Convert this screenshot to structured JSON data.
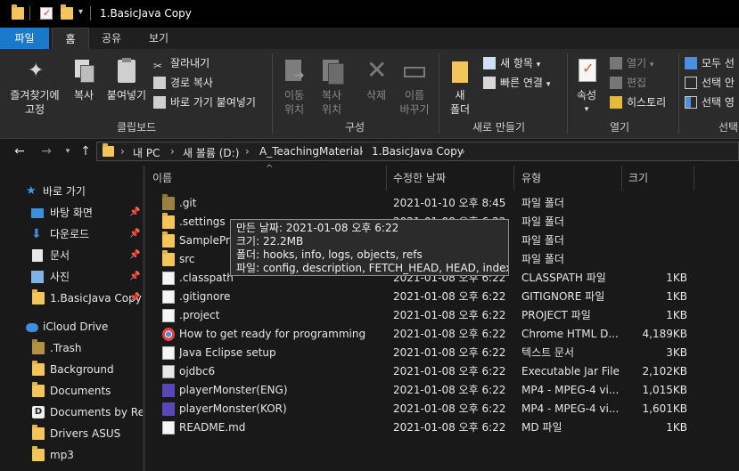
{
  "window": {
    "title": "1.BasicJava Copy"
  },
  "tabs": [
    {
      "label": "파일"
    },
    {
      "label": "홈"
    },
    {
      "label": "공유"
    },
    {
      "label": "보기"
    }
  ],
  "ribbon": {
    "clipboard": {
      "pin_label_1": "즐겨찾기에",
      "pin_label_2": "고정",
      "copy": "복사",
      "paste": "붙여넣기",
      "cut": "잘라내기",
      "copy_path": "경로 복사",
      "paste_shortcut": "바로 가기 붙여넣기",
      "group": "클립보드"
    },
    "organize": {
      "move_1": "이동",
      "move_2": "위치",
      "copyto_1": "복사",
      "copyto_2": "위치",
      "delete": "삭제",
      "rename_1": "이름",
      "rename_2": "바꾸기",
      "group": "구성"
    },
    "new": {
      "folder_1": "새",
      "folder_2": "폴더",
      "new_item": "새 항목",
      "easy_access": "빠른 연결",
      "group": "새로 만들기"
    },
    "open": {
      "properties": "속성",
      "open": "열기",
      "edit": "편집",
      "history": "히스토리",
      "group": "열기"
    },
    "select": {
      "select_all": "모두 선",
      "select_none": "선택 안",
      "invert": "선택 영",
      "group": "선택"
    }
  },
  "address": {
    "crumbs": [
      "내 PC",
      "새 볼륨 (D:)",
      "A_TeachingMaterial",
      "1.BasicJava Copy"
    ]
  },
  "nav": {
    "quick_access": "바로 가기",
    "items": [
      {
        "label": "바탕 화면",
        "icon": "desktop-icon"
      },
      {
        "label": "다운로드",
        "icon": "download-icon"
      },
      {
        "label": "문서",
        "icon": "document-icon"
      },
      {
        "label": "사진",
        "icon": "pictures-icon"
      },
      {
        "label": "1.BasicJava Copy",
        "icon": "folder-icon"
      }
    ],
    "icloud": "iCloud Drive",
    "icloud_items": [
      {
        "label": ".Trash"
      },
      {
        "label": "Background"
      },
      {
        "label": "Documents"
      },
      {
        "label": "Documents by Rea"
      },
      {
        "label": "Drivers ASUS"
      },
      {
        "label": "mp3"
      }
    ]
  },
  "columns": {
    "name": "이름",
    "date": "수정한 날짜",
    "type": "유형",
    "size": "크기"
  },
  "files": [
    {
      "name": ".git",
      "date": "2021-01-10 오후 8:45",
      "type": "파일 폴더",
      "size": "",
      "icon": "folder-icon",
      "dim": true
    },
    {
      "name": ".settings",
      "date": "2021-01-08 오후 6:22",
      "type": "파일 폴더",
      "size": "",
      "icon": "folder-icon"
    },
    {
      "name": "SampleProject",
      "date": "2021-01-08 오후 6:22",
      "type": "파일 폴더",
      "size": "",
      "icon": "folder-icon"
    },
    {
      "name": "src",
      "date": "2021-01-08 오후 6:22",
      "type": "파일 폴더",
      "size": "",
      "icon": "folder-icon"
    },
    {
      "name": ".classpath",
      "date": "2021-01-08 오후 6:22",
      "type": "CLASSPATH 파일",
      "size": "1KB",
      "icon": "file-icon"
    },
    {
      "name": ".gitignore",
      "date": "2021-01-08 오후 6:22",
      "type": "GITIGNORE 파일",
      "size": "1KB",
      "icon": "file-icon"
    },
    {
      "name": ".project",
      "date": "2021-01-08 오후 6:22",
      "type": "PROJECT 파일",
      "size": "1KB",
      "icon": "file-icon"
    },
    {
      "name": "How to get ready for programming",
      "date": "2021-01-08 오후 6:22",
      "type": "Chrome HTML D...",
      "size": "4,189KB",
      "icon": "chrome-icon"
    },
    {
      "name": "Java Eclipse setup",
      "date": "2021-01-08 오후 6:22",
      "type": "텍스트 문서",
      "size": "3KB",
      "icon": "text-file-icon"
    },
    {
      "name": "ojdbc6",
      "date": "2021-01-08 오후 6:22",
      "type": "Executable Jar File",
      "size": "2,102KB",
      "icon": "jar-icon"
    },
    {
      "name": "playerMonster(ENG)",
      "date": "2021-01-08 오후 6:22",
      "type": "MP4 - MPEG-4 vi...",
      "size": "1,015KB",
      "icon": "mp4-icon"
    },
    {
      "name": "playerMonster(KOR)",
      "date": "2021-01-08 오후 6:22",
      "type": "MP4 - MPEG-4 vi...",
      "size": "1,601KB",
      "icon": "mp4-icon"
    },
    {
      "name": "README.md",
      "date": "2021-01-08 오후 6:22",
      "type": "MD 파일",
      "size": "1KB",
      "icon": "file-icon"
    }
  ],
  "tooltip": {
    "line1": "만든 날짜: 2021-01-08 오후 6:22",
    "line2": "크기: 22.2MB",
    "line3": "폴더: hooks, info, logs, objects, refs",
    "line4": "파일: config, description, FETCH_HEAD, HEAD, index, ..."
  }
}
